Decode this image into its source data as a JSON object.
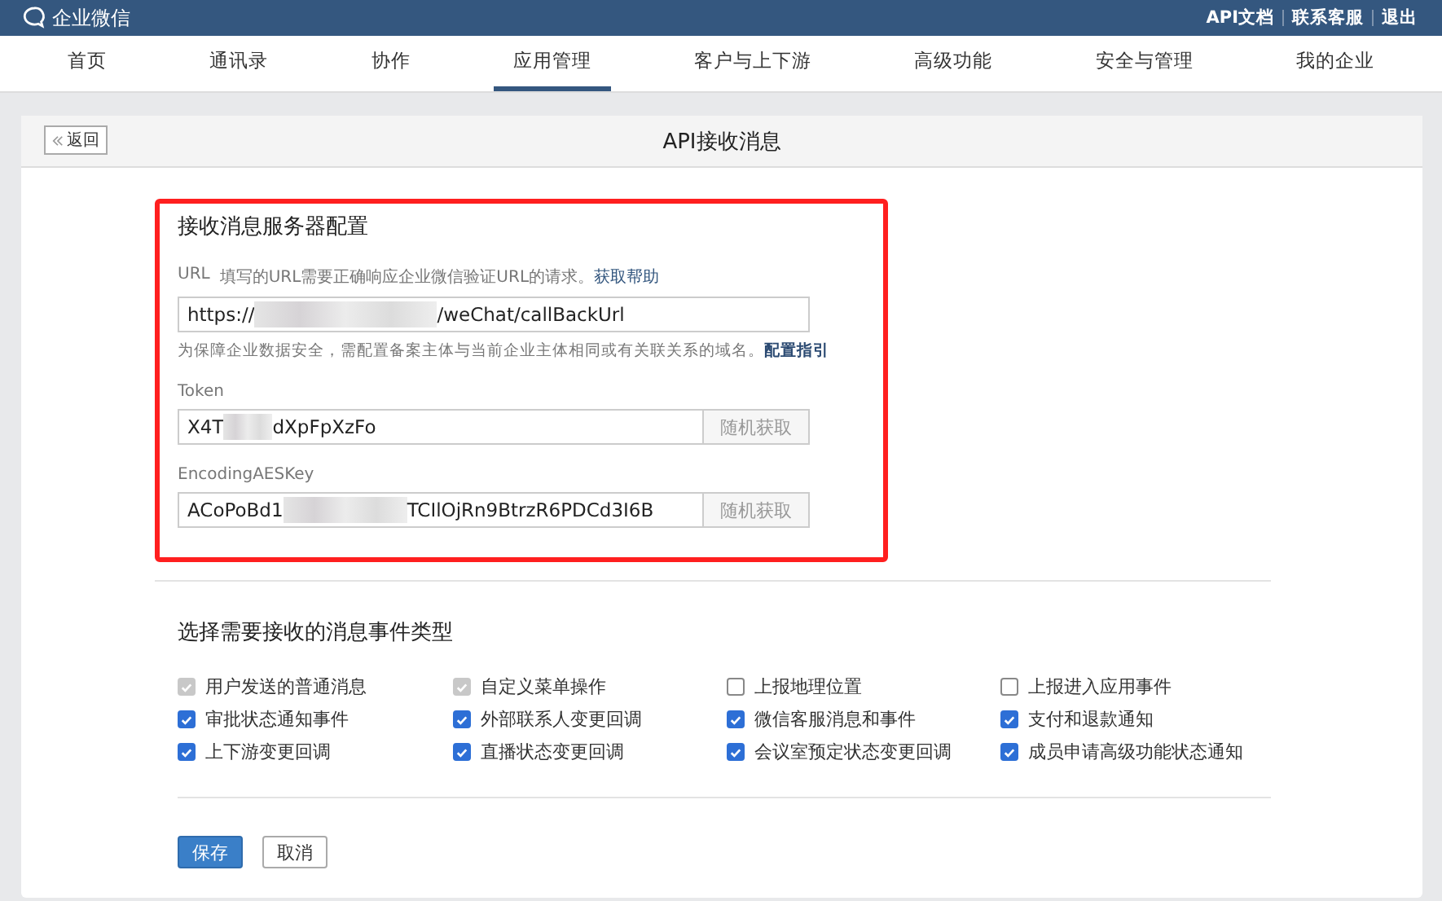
{
  "topbar": {
    "logo": "企业微信",
    "links": [
      "API文档",
      "联系客服",
      "退出"
    ]
  },
  "nav": [
    {
      "label": "首页",
      "selected": false
    },
    {
      "label": "通讯录",
      "selected": false
    },
    {
      "label": "协作",
      "selected": false
    },
    {
      "label": "应用管理",
      "selected": true
    },
    {
      "label": "客户与上下游",
      "selected": false
    },
    {
      "label": "高级功能",
      "selected": false
    },
    {
      "label": "安全与管理",
      "selected": false
    },
    {
      "label": "我的企业",
      "selected": false
    }
  ],
  "header": {
    "back": "返回",
    "title": "API接收消息"
  },
  "server_config": {
    "title": "接收消息服务器配置",
    "url": {
      "label": "URL",
      "hint": "填写的URL需要正确响应企业微信验证URL的请求。",
      "help_link": "获取帮助",
      "value_start": "https://",
      "value_end": "/weChat/callBackUrl",
      "note": "为保障企业数据安全，需配置备案主体与当前企业主体相同或有关联关系的域名。",
      "note_link": "配置指引"
    },
    "fields": [
      {
        "label": "Token",
        "value_start": "X4T",
        "value_end": "dXpFpXzFo",
        "button": "随机获取"
      },
      {
        "label": "EncodingAESKey",
        "value_start": "ACoPoBd1",
        "value_end": "TCIlOjRn9BtrzR6PDCd3I6B",
        "button": "随机获取"
      }
    ]
  },
  "events": {
    "title": "选择需要接收的消息事件类型",
    "items": [
      {
        "label": "用户发送的普通消息",
        "checked": true,
        "disabled": true
      },
      {
        "label": "自定义菜单操作",
        "checked": true,
        "disabled": true
      },
      {
        "label": "上报地理位置",
        "checked": false,
        "disabled": false
      },
      {
        "label": "上报进入应用事件",
        "checked": false,
        "disabled": false
      },
      {
        "label": "审批状态通知事件",
        "checked": true,
        "disabled": false
      },
      {
        "label": "外部联系人变更回调",
        "checked": true,
        "disabled": false
      },
      {
        "label": "微信客服消息和事件",
        "checked": true,
        "disabled": false
      },
      {
        "label": "支付和退款通知",
        "checked": true,
        "disabled": false
      },
      {
        "label": "上下游变更回调",
        "checked": true,
        "disabled": false
      },
      {
        "label": "直播状态变更回调",
        "checked": true,
        "disabled": false
      },
      {
        "label": "会议室预定状态变更回调",
        "checked": true,
        "disabled": false
      },
      {
        "label": "成员申请高级功能状态通知",
        "checked": true,
        "disabled": false
      }
    ]
  },
  "buttons": [
    {
      "label": "保存",
      "kind": "primary"
    },
    {
      "label": "取消",
      "kind": "secondary"
    }
  ]
}
